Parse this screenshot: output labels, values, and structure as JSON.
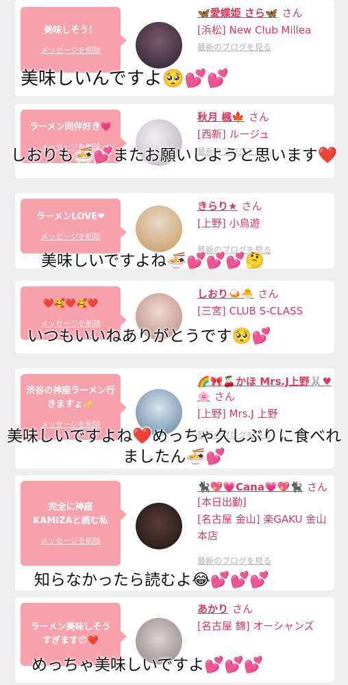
{
  "cards": [
    {
      "bubble": "美味しそう！",
      "delete_label": "メッセージを削除",
      "name": "🦋愛蝶姫 さら🦋",
      "honorific": "さん",
      "shop": "[浜松] New Club Millea",
      "blog": "最新のブログを見る",
      "avatar_colors": [
        "#2b2233",
        "#7a5a66"
      ]
    },
    {
      "bubble": "ラーメン同伴好き💗",
      "delete_label": "メッセージを削除",
      "name": "秋月 楓🍁",
      "honorific": "さん",
      "shop": "[西新] ルージュ",
      "blog": "最新のブログを見る",
      "avatar_colors": [
        "#e9e4ea",
        "#b9b0bb"
      ]
    },
    {
      "bubble": "ラーメンLOVE❤",
      "delete_label": "メッセージを削除",
      "name": "きらり★",
      "honorific": "さん",
      "shop": "[上野] 小鳥遊",
      "blog": "最新のブログを見る",
      "avatar_colors": [
        "#c99a63",
        "#e7d8c6"
      ]
    },
    {
      "bubble": "❤️🥰❤️🥰❤️",
      "delete_label": "メッセージを削除",
      "name": "しおり🍛🐣",
      "honorific": "さん",
      "shop": "[三宮] CLUB S-CLASS",
      "blog": "最新のブログを見る",
      "avatar_colors": [
        "#e8c9c0",
        "#b98a7c"
      ]
    },
    {
      "bubble": "渋谷の神座ラーメン行きますょ✨",
      "delete_label": "メッセージを削除",
      "name": "🌈🎀🍒かほ Mrs.J上野🐰♥🌸",
      "honorific": "さん",
      "shop": "[上野] Mrs.J 上野",
      "blog": "最新のブログを見る",
      "avatar_colors": [
        "#5d7f9c",
        "#d8e6ef"
      ]
    },
    {
      "bubble": "完全に神座KAMIZAと読む私",
      "delete_label": "メッセージを削除",
      "name": "🐈‍⬛💖💗Cana💗💖🐈‍⬛",
      "honorific": "さん[本日出勤]",
      "shop": "[名古屋 金山] 楽GAKU 金山本店",
      "blog": "最新のブログを見る",
      "avatar_colors": [
        "#1a1414",
        "#5a3c35"
      ]
    },
    {
      "bubble": "ラーメン美味しそうすぎます😍❤️",
      "delete_label": "メッセージを削除",
      "name": "あかり",
      "honorific": "さん",
      "shop": "[名古屋 錦] オーシャンズ",
      "blog": "最新のブログを見る",
      "avatar_colors": [
        "#d9d4d4",
        "#8f8383"
      ]
    }
  ],
  "captions": [
    "美味しいんですよ🥺💕💕",
    "しおりも🍜💕またお願いしようと思います❤️",
    "美味しいですよね🍜💕💕💕🤔",
    "いつもいいねありがとうです🥺💕",
    "美味しいですよね❤️めっちゃ久しぶりに食べれましたん🍜💕",
    "知らなかったら読むよ😂💕💕💕",
    "めっちゃ美味しいですよ💕💕💕"
  ],
  "colors": {
    "bubble": "#f7a1ad",
    "name": "#d63a5e",
    "background": "#eeeeee"
  }
}
